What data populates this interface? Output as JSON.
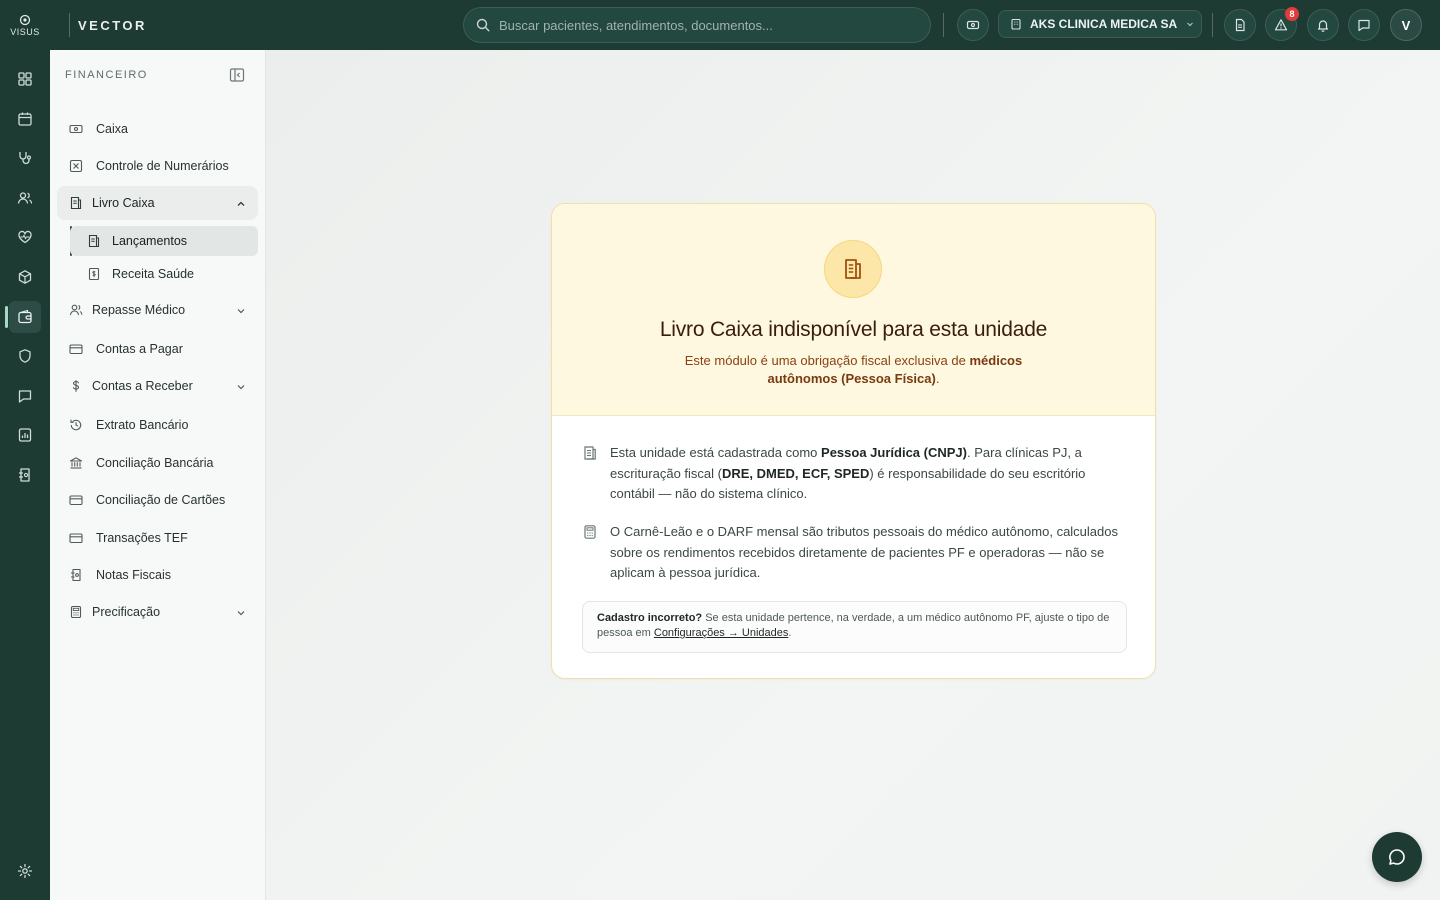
{
  "app": {
    "logo_text": "VISUS",
    "brand_name": "VECTOR"
  },
  "topbar": {
    "search_placeholder": "Buscar pacientes, atendimentos, documentos...",
    "clinic_name": "AKS CLINICA MEDICA SA",
    "alert_count": "8",
    "user_initial": "V"
  },
  "rail": {
    "items": [
      "dashboard-icon",
      "calendar-icon",
      "stethoscope-icon",
      "users-icon",
      "heart-pulse-icon",
      "box-icon",
      "wallet-icon",
      "shield-icon",
      "message-icon",
      "report-icon",
      "receipt-icon"
    ],
    "active": "wallet-icon",
    "footer": "settings-icon"
  },
  "sidebar": {
    "header": "FINANCEIRO",
    "items": {
      "caixa": "Caixa",
      "controle": "Controle de Numerários",
      "livro": "Livro Caixa",
      "lancamentos": "Lançamentos",
      "receita": "Receita Saúde",
      "repasse": "Repasse Médico",
      "pagar": "Contas a Pagar",
      "receber": "Contas a Receber",
      "extrato": "Extrato Bancário",
      "conciliacao": "Conciliação Bancária",
      "cartoes": "Conciliação de Cartões",
      "tef": "Transações TEF",
      "notas": "Notas Fiscais",
      "precificacao": "Precificação"
    }
  },
  "card": {
    "title": "Livro Caixa indisponível para esta unidade",
    "subtitle_prefix": "Este módulo é uma obrigação fiscal exclusiva de ",
    "subtitle_bold": "médicos autônomos (Pessoa Física)",
    "subtitle_suffix": ".",
    "para1": {
      "t1": "Esta unidade está cadastrada como ",
      "b1": "Pessoa Jurídica (CNPJ)",
      "t2": ". Para clínicas PJ, a escrituração fiscal (",
      "b2": "DRE, DMED, ECF, SPED",
      "t3": ") é responsabilidade do seu escritório contábil — não do sistema clínico."
    },
    "para2": "O Carnê-Leão e o DARF mensal são tributos pessoais do médico autônomo, calculados sobre os rendimentos recebidos diretamente de pacientes PF e operadoras — não se aplicam à pessoa jurídica.",
    "note": {
      "bold": "Cadastro incorreto?",
      "text": " Se esta unidade pertence, na verdade, a um médico autônomo PF, ajuste o tipo de pessoa em ",
      "link": "Configurações → Unidades",
      "end": "."
    }
  },
  "colors": {
    "primary": "#1d3a33",
    "warning_bg": "#fef8e1",
    "warning_text": "#8a4212",
    "badge": "#e23b3b"
  }
}
